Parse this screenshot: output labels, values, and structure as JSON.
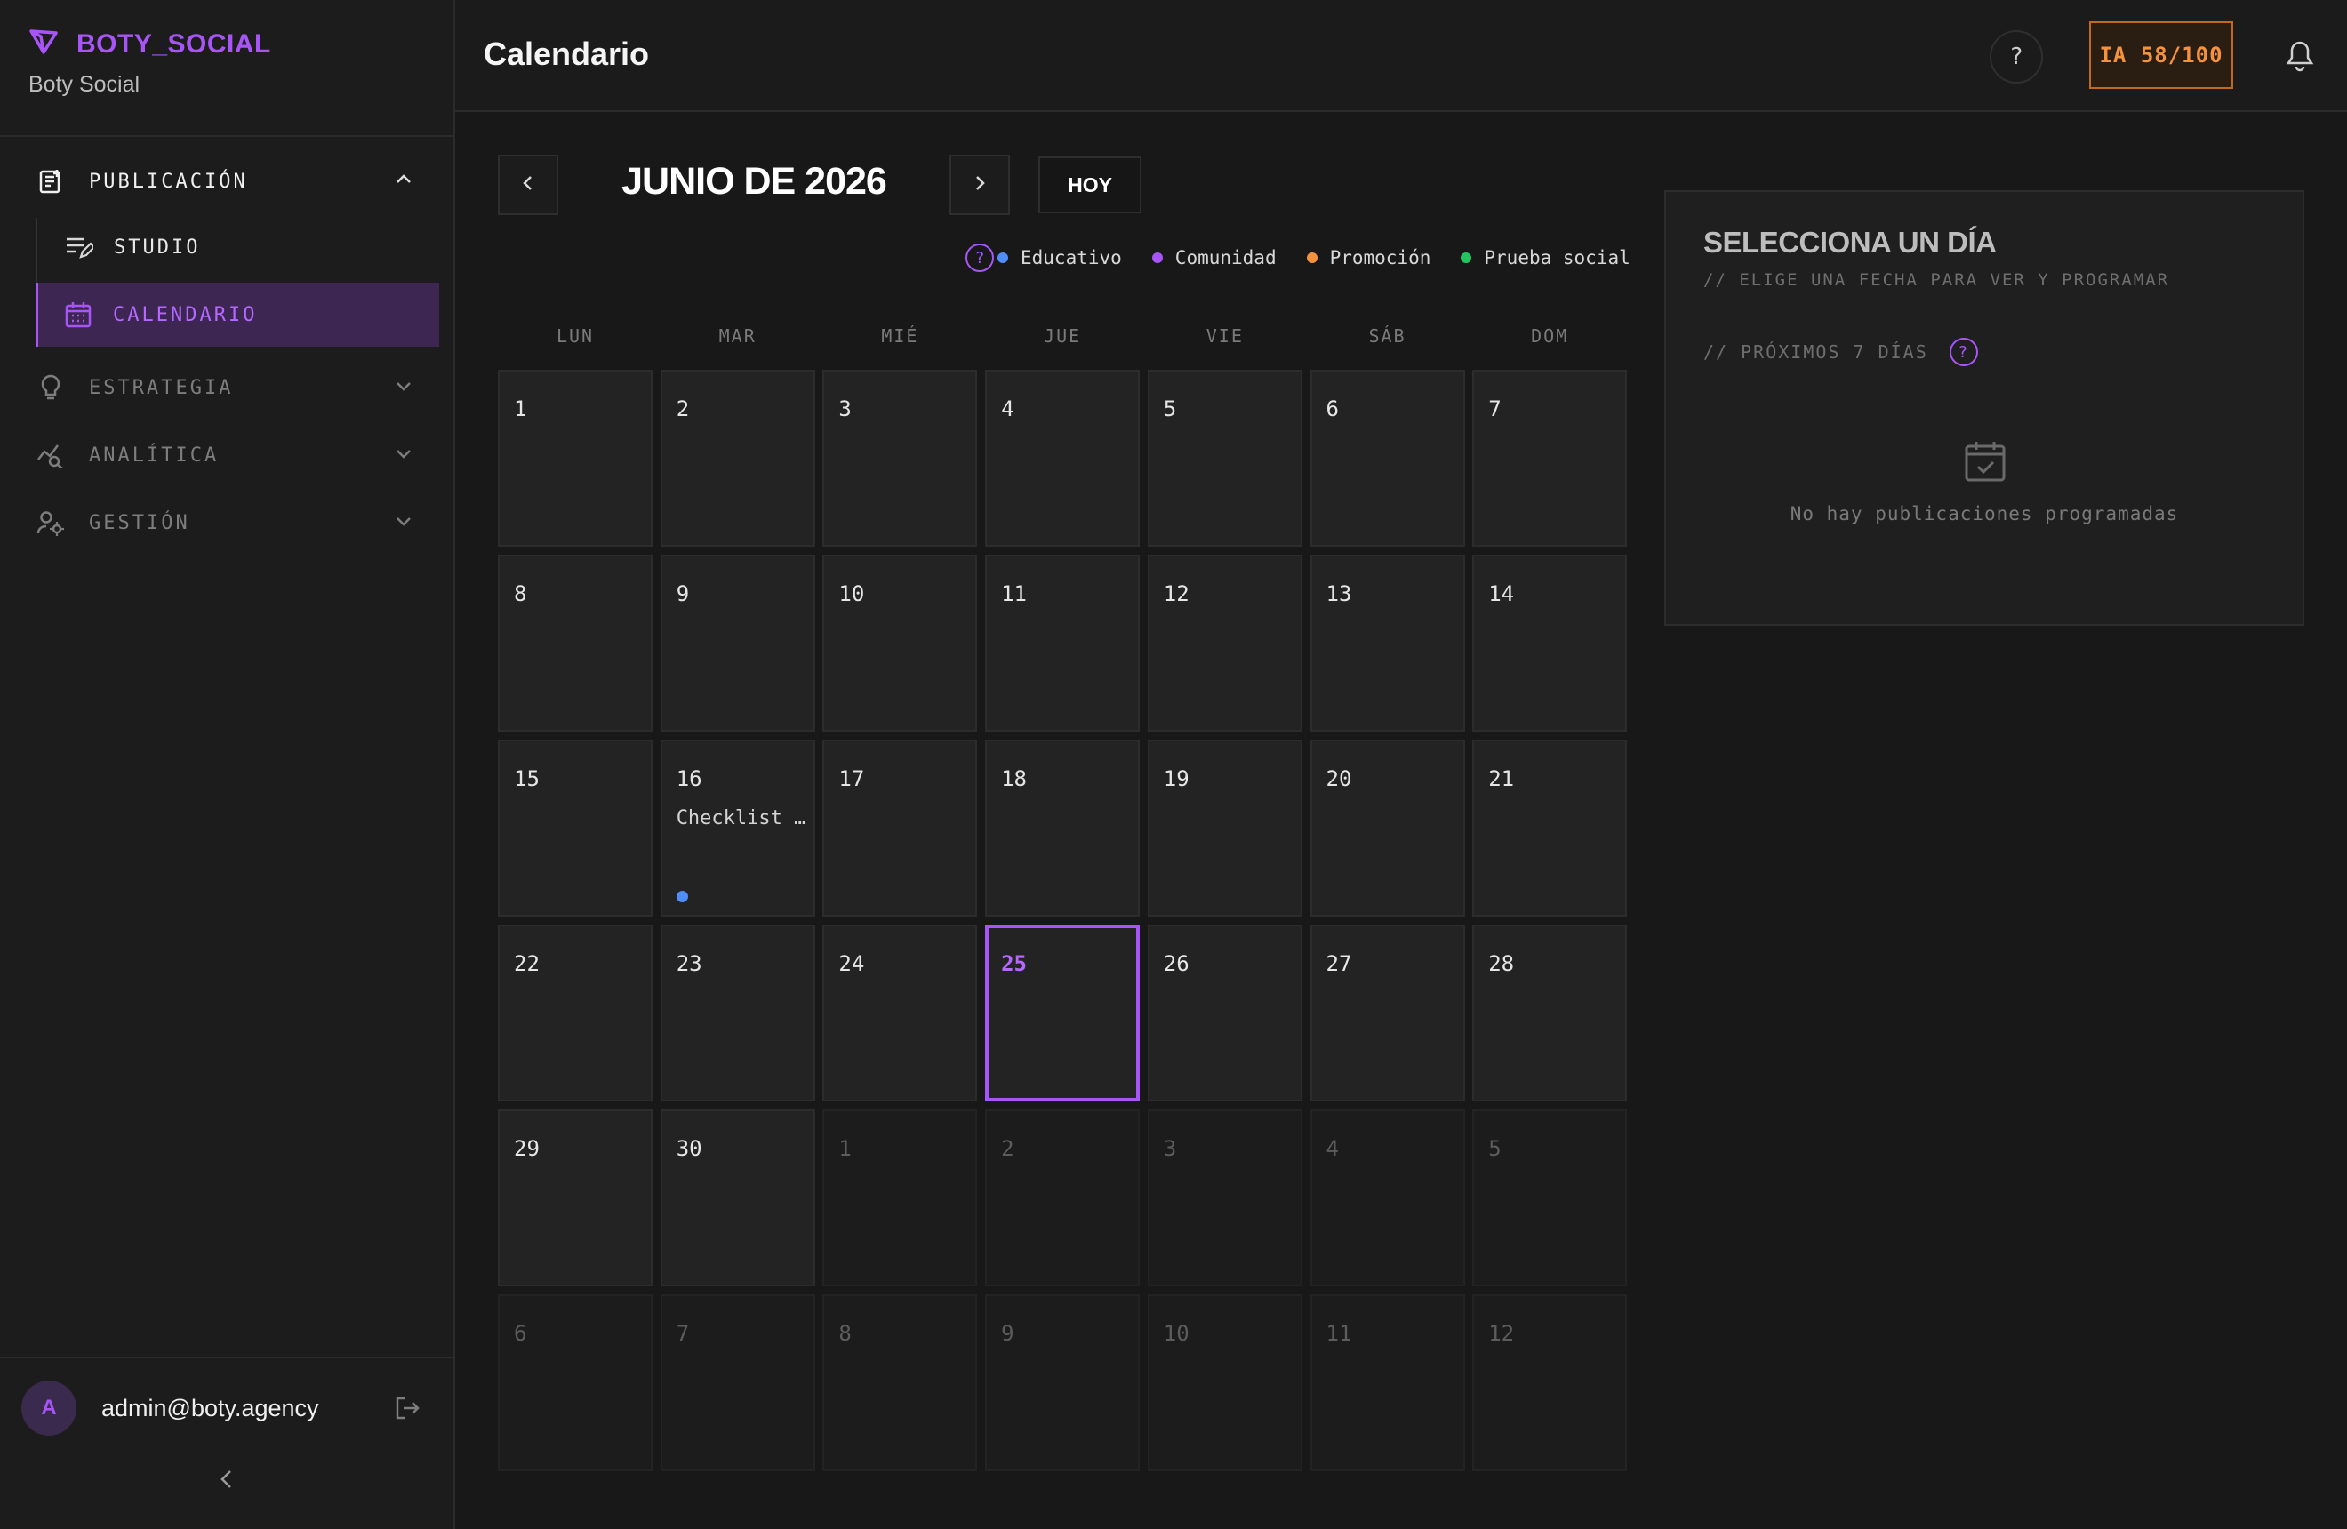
{
  "brand": {
    "name": "BOTY_SOCIAL",
    "subtitle": "Boty Social"
  },
  "sidebar": {
    "sections": [
      {
        "label": "PUBLICACIÓN",
        "icon": "publication-icon",
        "expanded": true
      },
      {
        "label": "ESTRATEGIA",
        "icon": "lightbulb-icon",
        "expanded": false
      },
      {
        "label": "ANALÍTICA",
        "icon": "analytics-icon",
        "expanded": false
      },
      {
        "label": "GESTIÓN",
        "icon": "management-icon",
        "expanded": false
      }
    ],
    "sub_items": [
      {
        "label": "STUDIO",
        "icon": "studio-icon",
        "active": false
      },
      {
        "label": "CALENDARIO",
        "icon": "calendar-icon",
        "active": true
      }
    ],
    "user": {
      "initial": "A",
      "email": "admin@boty.agency"
    }
  },
  "header": {
    "title": "Calendario",
    "help": "?",
    "ia_badge": "IA 58/100"
  },
  "calendar": {
    "month_title": "JUNIO DE 2026",
    "today_label": "HOY",
    "legend_help": "?",
    "legend": [
      {
        "label": "Educativo",
        "color": "#4f8ef7"
      },
      {
        "label": "Comunidad",
        "color": "#a855f7"
      },
      {
        "label": "Promoción",
        "color": "#f5923e"
      },
      {
        "label": "Prueba social",
        "color": "#22c55e"
      }
    ],
    "weekdays": [
      "LUN",
      "MAR",
      "MIÉ",
      "JUE",
      "VIE",
      "SÁB",
      "DOM"
    ],
    "today": 25,
    "days": [
      [
        "1",
        "2",
        "3",
        "4",
        "5",
        "6",
        "7"
      ],
      [
        "8",
        "9",
        "10",
        "11",
        "12",
        "13",
        "14"
      ],
      [
        "15",
        "16",
        "17",
        "18",
        "19",
        "20",
        "21"
      ],
      [
        "22",
        "23",
        "24",
        "25",
        "26",
        "27",
        "28"
      ],
      [
        "29",
        "30",
        "1",
        "2",
        "3",
        "4",
        "5"
      ],
      [
        "6",
        "7",
        "8",
        "9",
        "10",
        "11",
        "12"
      ]
    ],
    "events": [
      {
        "day": 16,
        "title": "Checklist …",
        "category": "Educativo"
      }
    ]
  },
  "panel": {
    "title": "SELECCIONA UN DÍA",
    "subtitle": "// ELIGE UNA FECHA PARA VER Y PROGRAMAR",
    "next_days": "// PRÓXIMOS 7 DÍAS",
    "next_help": "?",
    "empty": "No hay publicaciones programadas"
  },
  "colors": {
    "accent": "#a855f7",
    "ia_badge": "#f5923e",
    "background": "#181818"
  }
}
